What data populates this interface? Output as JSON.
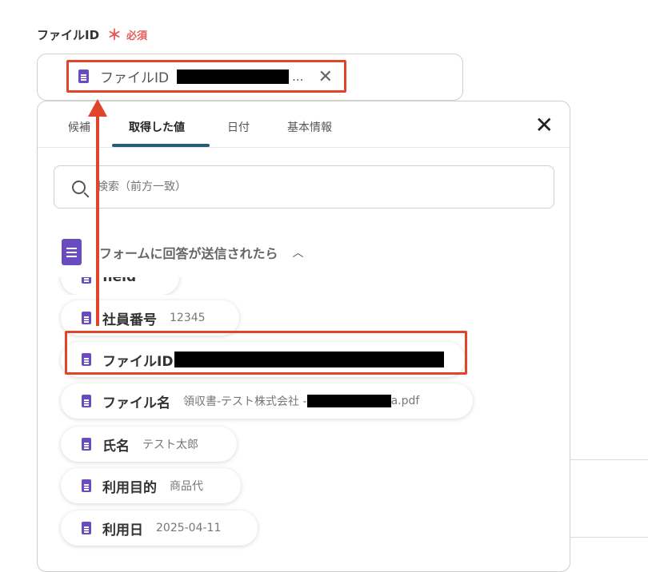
{
  "field": {
    "label": "ファイルID",
    "required_star": "＊",
    "required_text": "必須",
    "chip_label": "ファイルID",
    "chip_ellipsis": "..."
  },
  "tabs": [
    {
      "label": "候補"
    },
    {
      "label": "取得した値"
    },
    {
      "label": "日付"
    },
    {
      "label": "基本情報"
    }
  ],
  "search": {
    "placeholder": "検索（前方一致）"
  },
  "group": {
    "label": "フォームに回答が送信されたら"
  },
  "items": [
    {
      "name": "field",
      "value": ""
    },
    {
      "name": "社員番号",
      "value": "12345"
    },
    {
      "name": "ファイルID",
      "value": ""
    },
    {
      "name": "ファイル名",
      "value_prefix": "領収書-テスト株式会社 -",
      "value_suffix": "a.pdf"
    },
    {
      "name": "氏名",
      "value": "テスト太郎"
    },
    {
      "name": "利用目的",
      "value": "商品代"
    },
    {
      "name": "利用日",
      "value": "2025-04-11"
    }
  ],
  "colors": {
    "accent_red": "#e0452b",
    "icon_purple": "#6a4cc0",
    "tab_underline": "#2a5a78",
    "required": "#e85a5a"
  }
}
